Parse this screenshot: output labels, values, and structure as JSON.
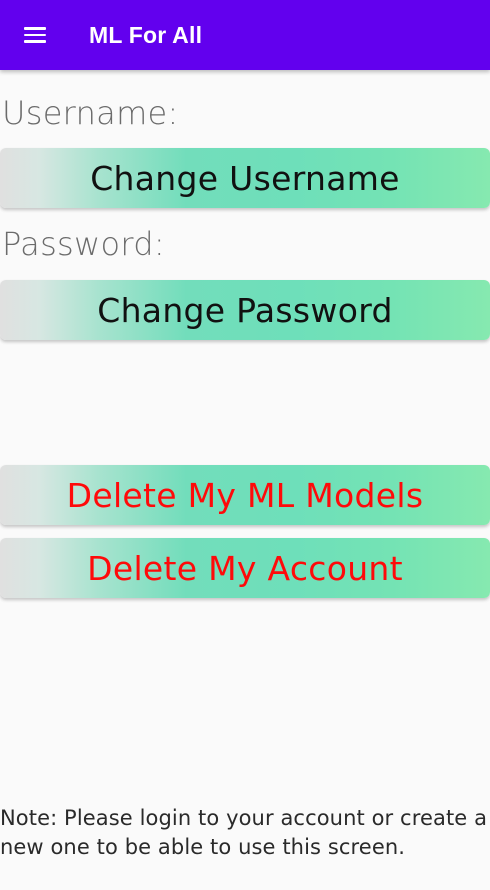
{
  "app_bar": {
    "title": "ML For All",
    "menu_icon": "hamburger-menu-icon",
    "color": "#6200ee"
  },
  "account": {
    "username_label": "Username:",
    "change_username_button": "Change Username",
    "password_label": "Password:",
    "change_password_button": "Change Password"
  },
  "danger_zone": {
    "delete_models_button": "Delete My ML Models",
    "delete_account_button": "Delete My Account",
    "text_color": "#ff0a0a"
  },
  "note": "Note: Please login to your account or create a new one to be able to use this screen."
}
